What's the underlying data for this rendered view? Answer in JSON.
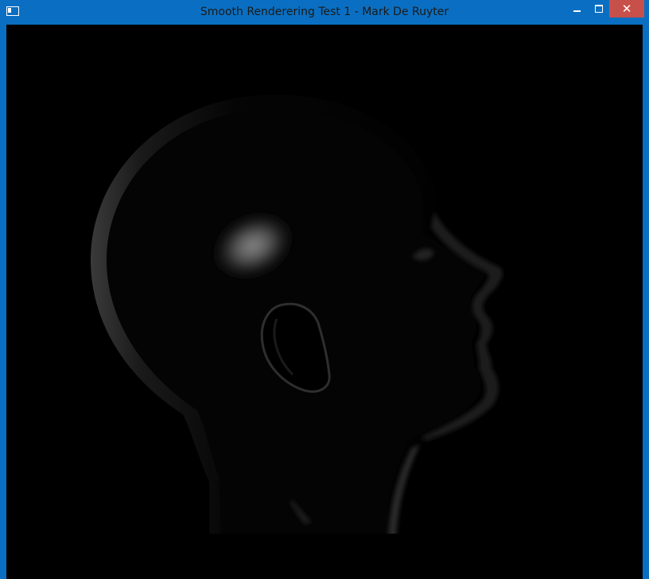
{
  "window": {
    "title": "Smooth Renderering Test 1 - Mark De Ruyter",
    "controls": {
      "minimize_glyph": "",
      "maximize_glyph": "",
      "close_glyph": "✕"
    }
  },
  "viewport": {
    "background": "#000000"
  },
  "colors": {
    "titlebar": "#0a6fc2",
    "close_button": "#c7504a",
    "title_text": "#1a1a1a"
  },
  "icons": {
    "app": "app-window-icon",
    "minimize": "minimize-icon",
    "maximize": "maximize-icon",
    "close": "close-icon"
  }
}
